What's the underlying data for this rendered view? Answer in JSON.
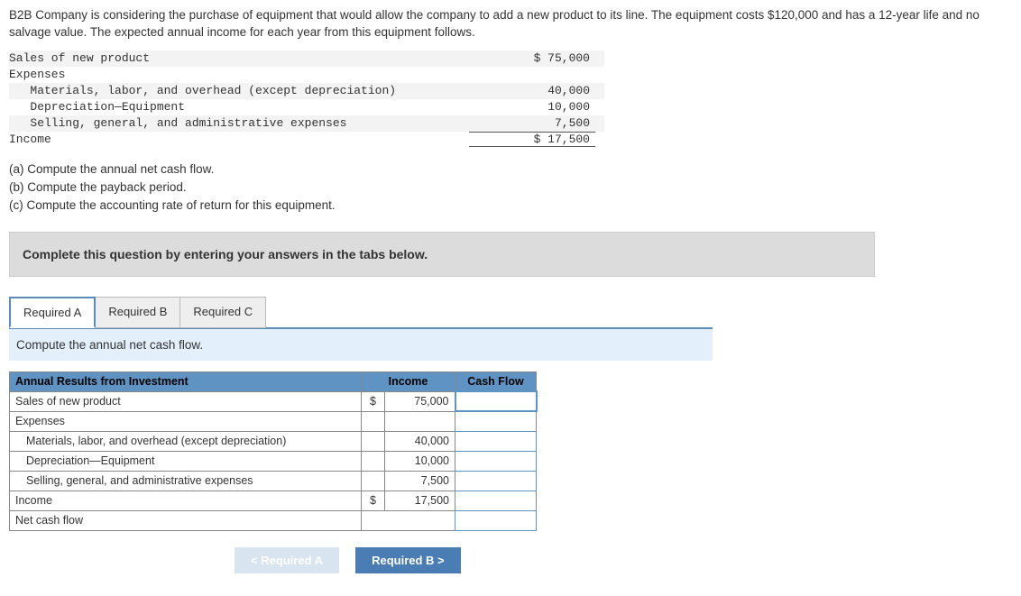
{
  "intro": "B2B Company is considering the purchase of equipment that would allow the company to add a new product to its line. The equipment costs $120,000 and has a 12-year life and no salvage value. The expected annual income for each year from this equipment follows.",
  "given": {
    "rows": [
      {
        "label": "Sales of new product",
        "value": "$ 75,000"
      },
      {
        "label": "Expenses",
        "value": ""
      },
      {
        "label": "   Materials, labor, and overhead (except depreciation)",
        "value": "40,000"
      },
      {
        "label": "   Depreciation—Equipment",
        "value": "10,000"
      },
      {
        "label": "   Selling, general, and administrative expenses",
        "value": "7,500"
      },
      {
        "label": "Income",
        "value": "$ 17,500"
      }
    ]
  },
  "questions": {
    "a": "(a) Compute the annual net cash flow.",
    "b": "(b) Compute the payback period.",
    "c": "(c) Compute the accounting rate of return for this equipment."
  },
  "instruction": "Complete this question by entering your answers in the tabs below.",
  "tabs": {
    "a": "Required A",
    "b": "Required B",
    "c": "Required C"
  },
  "sub_instruction": "Compute the annual net cash flow.",
  "answer_table": {
    "headers": {
      "main": "Annual Results from Investment",
      "income": "Income",
      "cashflow": "Cash Flow"
    },
    "rows": {
      "sales": {
        "label": "Sales of new product",
        "cur": "$",
        "num": "75,000"
      },
      "exp": {
        "label": "Expenses"
      },
      "mlo": {
        "label": "Materials, labor, and overhead (except depreciation)",
        "num": "40,000"
      },
      "dep": {
        "label": "Depreciation—Equipment",
        "num": "10,000"
      },
      "sga": {
        "label": "Selling, general, and administrative expenses",
        "num": "7,500"
      },
      "income": {
        "label": "Income",
        "cur": "$",
        "num": "17,500"
      },
      "netcf": {
        "label": "Net cash flow"
      }
    }
  },
  "nav": {
    "prev": "<  Required A",
    "next": "Required B  >"
  }
}
